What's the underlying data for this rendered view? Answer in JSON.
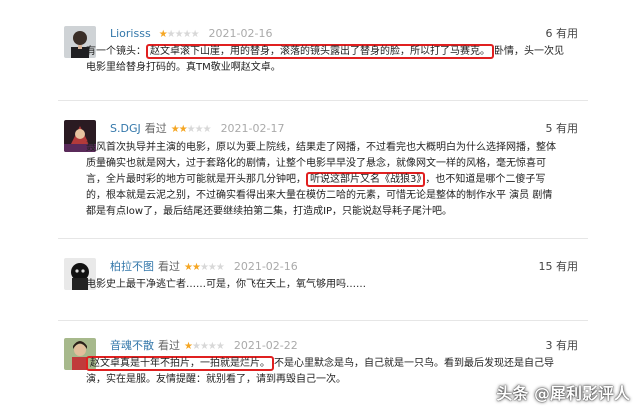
{
  "reviews": [
    {
      "user": "Liorisss",
      "status": "",
      "rating": 1,
      "date": "2021-02-16",
      "votes": "6 有用",
      "lines": [
        {
          "pre": "有一个镜头：",
          "hl": "赵文卓滚下山崖，用的替身，滚落的镜头露出了替身的脸，所以打了马赛克。",
          "post": "卧情，头一次见"
        },
        {
          "pre": "电影里给替身打码的。真TM敬业啊赵文卓。",
          "hl": "",
          "post": ""
        }
      ]
    },
    {
      "user": "S.DGJ",
      "status": "看过",
      "rating": 2,
      "date": "2021-02-17",
      "votes": "5 有用",
      "lines": [
        {
          "pre": "聂风首次执导并主演的电影，原以为要上院线，结果走了网播，不过看完也大概明白为什么选择网播，整体",
          "hl": "",
          "post": ""
        },
        {
          "pre": "质量确实也就是网大，过于套路化的剧情，让整个电影早早没了悬念，就像网文一样的风格，毫无惊喜可",
          "hl": "",
          "post": ""
        },
        {
          "pre": "言，全片最时彩的地方可能就是开头那几分钟吧，",
          "hl": "听说这部片又名《战狼3》",
          "post": "，也不知道是哪个二傻子写"
        },
        {
          "pre": "的，根本就是云泥之别，不过确实看得出来大量在模仿二哈的元素，可惜无论是整体的制作水平 演员 剧情",
          "hl": "",
          "post": ""
        },
        {
          "pre": "都是有点low了，最后结尾还要继续拍第二集，打造成IP，只能说赵导耗子尾汁吧。",
          "hl": "",
          "post": ""
        }
      ]
    },
    {
      "user": "柏拉不图",
      "status": "看过",
      "rating": 2,
      "date": "2021-02-16",
      "votes": "15 有用",
      "lines": [
        {
          "pre": "电影史上最干净逃亡者……可是，你飞在天上，氧气够用吗……",
          "hl": "",
          "post": ""
        }
      ]
    },
    {
      "user": "音魂不散",
      "status": "看过",
      "rating": 1,
      "date": "2021-02-22",
      "votes": "3 有用",
      "lines": [
        {
          "pre": "",
          "hl": "赵文卓真是十年不拍片，一拍就是烂片。",
          "post": "不是心里默念是鸟，自己就是一只鸟。看到最后发现还是自己导"
        },
        {
          "pre": "演，实在是服。友情提醒：就别看了，请到再毁自己一次。",
          "hl": "",
          "post": ""
        }
      ]
    }
  ],
  "watermark": "头条 @犀利影评人"
}
